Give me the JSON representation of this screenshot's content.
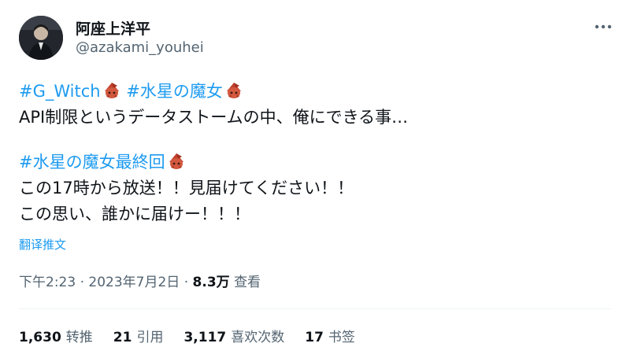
{
  "author": {
    "name": "阿座上洋平",
    "handle": "@azakami_youhei"
  },
  "icons": {
    "more": "more-horizontal-icon",
    "hashtag_emoji": "witch-emoji-icon"
  },
  "tweet": {
    "lines": [
      {
        "tags": [
          "#G_Witch",
          "#水星の魔女"
        ]
      },
      {
        "text": "API制限というデータストームの中、俺にできる事…"
      },
      {
        "tags": [
          "#水星の魔女最終回"
        ]
      },
      {
        "text": "この17時から放送！！見届けてください！！"
      },
      {
        "text": "この思い、誰かに届けー！！！"
      }
    ]
  },
  "translate_label": "翻译推文",
  "meta": {
    "time": "下午2:23",
    "separator": "·",
    "date": "2023年7月2日",
    "views_count": "8.3万",
    "views_label": "查看"
  },
  "stats": [
    {
      "count": "1,630",
      "label": "转推"
    },
    {
      "count": "21",
      "label": "引用"
    },
    {
      "count": "3,117",
      "label": "喜欢次数"
    },
    {
      "count": "17",
      "label": "书签"
    }
  ],
  "colors": {
    "accent": "#1d9bf0",
    "text": "#0f1419",
    "secondary": "#536471"
  }
}
